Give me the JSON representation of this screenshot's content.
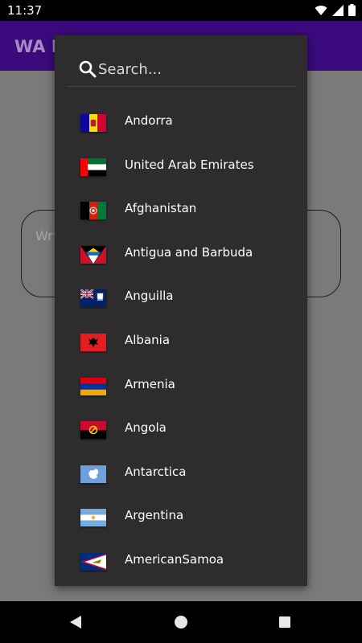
{
  "status_bar": {
    "time": "11:37",
    "icons": [
      "wifi-icon",
      "signal-icon",
      "battery-icon"
    ]
  },
  "app": {
    "title": "WA D",
    "input_hint": "Wr"
  },
  "dialog": {
    "search": {
      "placeholder": "Search..."
    },
    "countries": [
      {
        "name": "Andorra",
        "flag": "andorra-flag"
      },
      {
        "name": "United Arab Emirates",
        "flag": "uae-flag"
      },
      {
        "name": "Afghanistan",
        "flag": "afghanistan-flag"
      },
      {
        "name": "Antigua and Barbuda",
        "flag": "antigua-flag"
      },
      {
        "name": "Anguilla",
        "flag": "anguilla-flag"
      },
      {
        "name": "Albania",
        "flag": "albania-flag"
      },
      {
        "name": "Armenia",
        "flag": "armenia-flag"
      },
      {
        "name": "Angola",
        "flag": "angola-flag"
      },
      {
        "name": "Antarctica",
        "flag": "antarctica-flag"
      },
      {
        "name": "Argentina",
        "flag": "argentina-flag"
      },
      {
        "name": "AmericanSamoa",
        "flag": "american-samoa-flag"
      }
    ]
  },
  "nav_bar": {
    "buttons": [
      "back-icon",
      "home-icon",
      "recents-icon"
    ]
  },
  "colors": {
    "app_bar": "#3b0a7c",
    "dialog_bg": "#2e2c2c",
    "scrim": "#7a7a7a"
  }
}
